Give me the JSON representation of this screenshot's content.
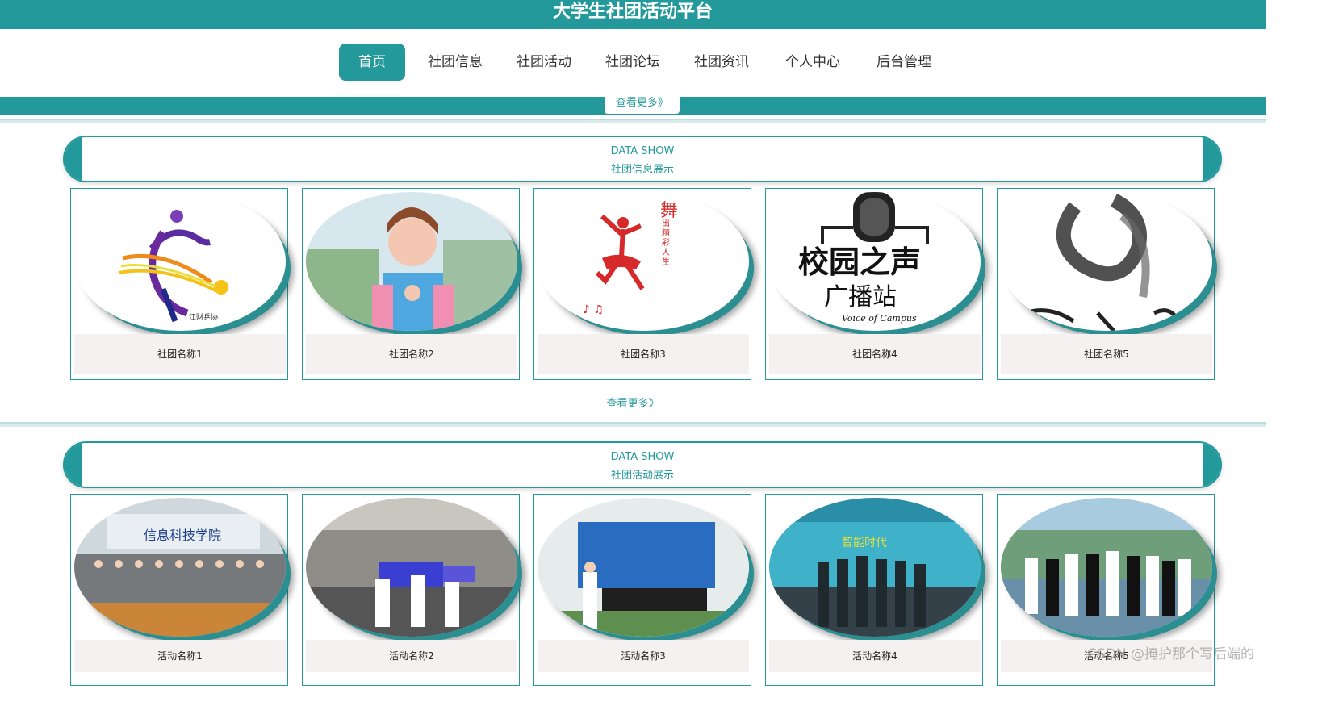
{
  "header": {
    "site_title": "大学生社团活动平台"
  },
  "nav": {
    "items": [
      {
        "label": "首页",
        "active": true
      },
      {
        "label": "社团信息"
      },
      {
        "label": "社团活动"
      },
      {
        "label": "社团论坛"
      },
      {
        "label": "社团资讯"
      },
      {
        "label": "个人中心"
      },
      {
        "label": "后台管理"
      }
    ]
  },
  "banner": {
    "more_label": "查看更多》"
  },
  "clubs": {
    "heading_en": "DATA SHOW",
    "heading_cn": "社团信息展示",
    "items": [
      {
        "name": "社团名称1"
      },
      {
        "name": "社团名称2"
      },
      {
        "name": "社团名称3"
      },
      {
        "name": "社团名称4",
        "logo_line1": "校园之声",
        "logo_line2": "广播站",
        "logo_line3": "Voice of Campus"
      },
      {
        "name": "社团名称5"
      }
    ],
    "more_label": "查看更多》"
  },
  "activities": {
    "heading_en": "DATA SHOW",
    "heading_cn": "社团活动展示",
    "items": [
      {
        "name": "活动名称1"
      },
      {
        "name": "活动名称2"
      },
      {
        "name": "活动名称3"
      },
      {
        "name": "活动名称4"
      },
      {
        "name": "活动名称5"
      }
    ]
  },
  "watermark": "CSDN @掩护那个写后端的",
  "colors": {
    "accent": "#24999c",
    "caption_bg": "#f5f1f0"
  }
}
